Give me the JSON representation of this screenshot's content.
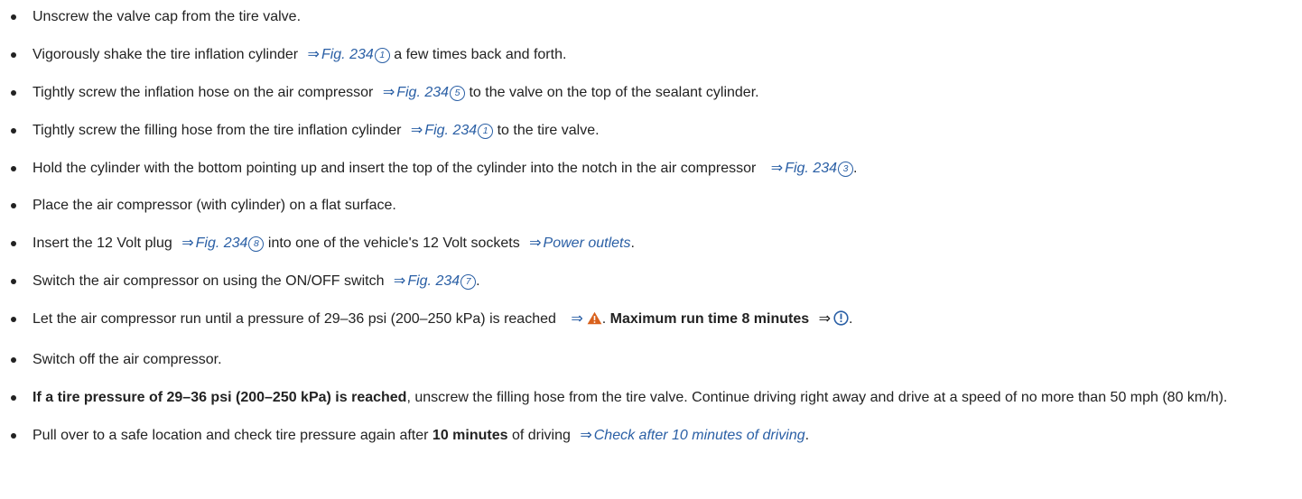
{
  "colors": {
    "link": "#2a5fa5",
    "text": "#222222",
    "warning": "#d9611c",
    "notice": "#2a5fa5"
  },
  "arrow": "⇒",
  "steps": [
    {
      "text": "Unscrew the valve cap from the tire valve."
    },
    {
      "a": "Vigorously shake the tire inflation cylinder",
      "ref": "Fig. 234",
      "num": "1",
      "b": "a few times back and forth."
    },
    {
      "a": "Tightly screw the inflation hose on the air compressor",
      "ref": "Fig. 234",
      "num": "5",
      "b": "to the valve on the top of the sealant cylinder."
    },
    {
      "a": "Tightly screw the filling hose from the tire inflation cylinder",
      "ref": "Fig. 234",
      "num": "1",
      "b": "to the tire valve."
    },
    {
      "a": "Hold the cylinder with the bottom pointing up and insert the top of the cylinder into the notch in the air compressor",
      "ref": "Fig. 234",
      "num": "3",
      "b": "."
    },
    {
      "text": "Place the air compressor (with cylinder) on a flat surface."
    },
    {
      "a": "Insert the 12 Volt plug",
      "ref": "Fig. 234",
      "num": "8",
      "b": "into one of the vehicle's 12 Volt sockets",
      "ref2": "Power outlets",
      "c": "."
    },
    {
      "a": "Switch the air compressor on using the ON/OFF switch",
      "ref": "Fig. 234",
      "num": "7",
      "b": "."
    },
    {
      "a": "Let the air compressor run until a pressure of 29–36 psi (200–250 kPa) is reached",
      "dot": ".",
      "bold": "Maximum run time 8 minutes",
      "end": ".",
      "warning_icon": "warning-triangle-icon",
      "notice_icon": "notice-exclamation-icon"
    },
    {
      "text": "Switch off the air compressor."
    },
    {
      "bold": "If a tire pressure of 29–36 psi (200–250 kPa) is reached",
      "rest": ", unscrew the filling hose from the tire valve. Continue driving right away and drive at a speed of no more than 50 mph (80 km/h)."
    },
    {
      "a": "Pull over to a safe location and check tire pressure again after",
      "bold": "10 minutes",
      "b": "of driving",
      "ref": "Check after 10 minutes of driving",
      "end": "."
    }
  ]
}
